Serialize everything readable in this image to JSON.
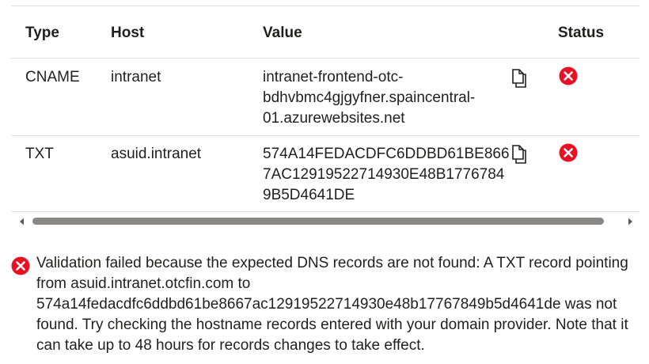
{
  "headers": {
    "type": "Type",
    "host": "Host",
    "value": "Value",
    "status": "Status"
  },
  "records": [
    {
      "type": "CNAME",
      "host": "intranet",
      "value_lines": [
        "intranet-frontend-otc-",
        "bdhvbmc4gjgyfner.spaincentral-",
        "01.azurewebsites.net"
      ],
      "copy_icon": "copy-icon",
      "status_icon": "error-icon"
    },
    {
      "type": "TXT",
      "host": "asuid.intranet",
      "value_lines": [
        "574A14FEDACDFC6DDBD61BE866",
        "7AC12919522714930E48B1776784",
        "9B5D4641DE"
      ],
      "copy_icon": "copy-icon",
      "status_icon": "error-icon"
    }
  ],
  "validation_message": "Validation failed because the expected DNS records are not found: A TXT record pointing from asuid.intranet.otcfin.com to 574a14fedacdfc6ddbd61be8667ac12919522714930e48b17767849b5d4641de was not found. Try checking the hostname records entered with your domain provider. Note that it can take up to 48 hours for records changes to take effect.",
  "colors": {
    "error": "#e81123",
    "border": "#e1dfdd",
    "scroll_thumb": "#8a8886",
    "text": "#201f1e"
  }
}
